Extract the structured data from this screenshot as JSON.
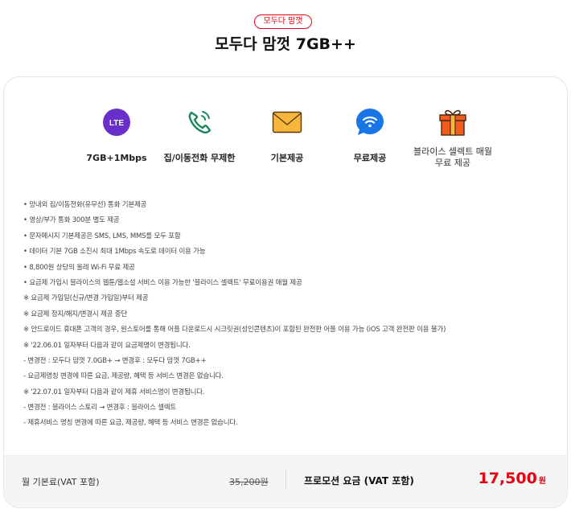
{
  "header": {
    "tag": "모두다 맘껏",
    "title": "모두다 맘껏 7GB++"
  },
  "features": [
    {
      "icon": "lte-icon",
      "label": "7GB+1Mbps"
    },
    {
      "icon": "phone-call-icon",
      "label": "집/이동전화 무제한"
    },
    {
      "icon": "envelope-icon",
      "label": "기본제공"
    },
    {
      "icon": "wifi-icon",
      "label": "무료제공"
    },
    {
      "icon": "gift-icon",
      "label": "블라이스 셀렉트 매월 무료 제공"
    }
  ],
  "icon_text": {
    "lte": "LTE"
  },
  "notes": [
    "• 망내외 집/이동전화(유무선) 통화 기본제공",
    "• 영상/부가 통화 300분 별도 제공",
    "• 문자메시지 기본제공은 SMS, LMS, MMS를 모두 포함",
    "• 데이터 기본 7GB 소진시 최대 1Mbps 속도로 데이터 이용 가능",
    "• 8,800원 상당의 올레 Wi-Fi 무료 제공",
    "• 요금제 가입시 블라이스의 웹툰/웹소설 서비스 이용 가능한 '블라이스 셀렉트' 무료이용권 매월 제공",
    "※ 요금제 가입일(신규/변경 가입일)부터 제공",
    "※ 요금제 정지/해지/변경시 제공 중단",
    "※ 안드로이드 휴대폰 고객의 경우, 원스토어를 통해 어플 다운로드시 시크릿권(성인콘텐츠)이 포함된 완전판 어플 이용 가능 (iOS 고객 완전판 이용 불가)",
    "※ '22.06.01 일자부터 다음과 같이 요금제명이 변경됩니다.",
    "- 변경전 : 모두다 맘껏 7.0GB+ → 변경후 : 모두다 맘껏 7GB++",
    "- 요금제명칭 변경에 따른 요금, 제공량, 혜택 등 서비스 변경은 없습니다.",
    "※ '22.07.01 일자부터 다음과 같이 제휴 서비스명이 변경됩니다.",
    "- 변경전 : 블라이스 스토리 → 변경후 : 블라이스 셀렉트",
    "- 제휴서비스 명칭 변경에 따른 요금, 제공량, 혜택 등 서비스 변경은 없습니다."
  ],
  "footer": {
    "base_label": "월 기본료(VAT 포함)",
    "base_price": "35,200원",
    "promo_label": "프로모션 요금 (VAT 포함)",
    "promo_price": "17,500",
    "promo_unit": "원"
  },
  "colors": {
    "accent": "#e60012",
    "lte_purple": "#6a2fc9",
    "phone_green": "#1a8a5a",
    "envelope_yellow": "#f6b73c",
    "wifi_blue": "#1976e8",
    "gift_orange": "#f25d1f"
  }
}
